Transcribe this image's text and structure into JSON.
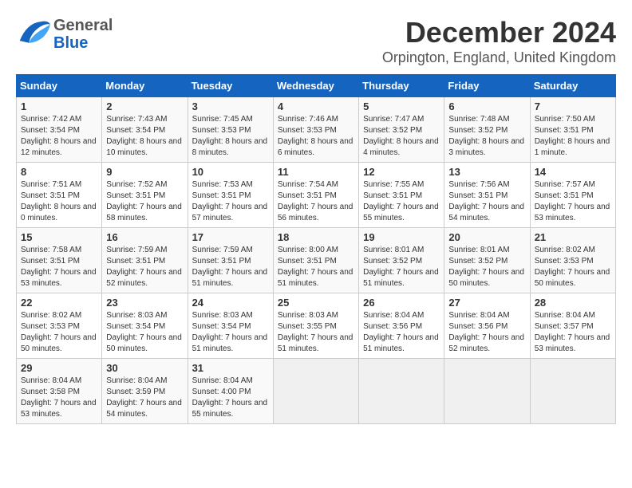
{
  "header": {
    "logo_general": "General",
    "logo_blue": "Blue",
    "title": "December 2024",
    "subtitle": "Orpington, England, United Kingdom"
  },
  "columns": [
    "Sunday",
    "Monday",
    "Tuesday",
    "Wednesday",
    "Thursday",
    "Friday",
    "Saturday"
  ],
  "weeks": [
    [
      {
        "day": "1",
        "sunrise": "Sunrise: 7:42 AM",
        "sunset": "Sunset: 3:54 PM",
        "daylight": "Daylight: 8 hours and 12 minutes."
      },
      {
        "day": "2",
        "sunrise": "Sunrise: 7:43 AM",
        "sunset": "Sunset: 3:54 PM",
        "daylight": "Daylight: 8 hours and 10 minutes."
      },
      {
        "day": "3",
        "sunrise": "Sunrise: 7:45 AM",
        "sunset": "Sunset: 3:53 PM",
        "daylight": "Daylight: 8 hours and 8 minutes."
      },
      {
        "day": "4",
        "sunrise": "Sunrise: 7:46 AM",
        "sunset": "Sunset: 3:53 PM",
        "daylight": "Daylight: 8 hours and 6 minutes."
      },
      {
        "day": "5",
        "sunrise": "Sunrise: 7:47 AM",
        "sunset": "Sunset: 3:52 PM",
        "daylight": "Daylight: 8 hours and 4 minutes."
      },
      {
        "day": "6",
        "sunrise": "Sunrise: 7:48 AM",
        "sunset": "Sunset: 3:52 PM",
        "daylight": "Daylight: 8 hours and 3 minutes."
      },
      {
        "day": "7",
        "sunrise": "Sunrise: 7:50 AM",
        "sunset": "Sunset: 3:51 PM",
        "daylight": "Daylight: 8 hours and 1 minute."
      }
    ],
    [
      {
        "day": "8",
        "sunrise": "Sunrise: 7:51 AM",
        "sunset": "Sunset: 3:51 PM",
        "daylight": "Daylight: 8 hours and 0 minutes."
      },
      {
        "day": "9",
        "sunrise": "Sunrise: 7:52 AM",
        "sunset": "Sunset: 3:51 PM",
        "daylight": "Daylight: 7 hours and 58 minutes."
      },
      {
        "day": "10",
        "sunrise": "Sunrise: 7:53 AM",
        "sunset": "Sunset: 3:51 PM",
        "daylight": "Daylight: 7 hours and 57 minutes."
      },
      {
        "day": "11",
        "sunrise": "Sunrise: 7:54 AM",
        "sunset": "Sunset: 3:51 PM",
        "daylight": "Daylight: 7 hours and 56 minutes."
      },
      {
        "day": "12",
        "sunrise": "Sunrise: 7:55 AM",
        "sunset": "Sunset: 3:51 PM",
        "daylight": "Daylight: 7 hours and 55 minutes."
      },
      {
        "day": "13",
        "sunrise": "Sunrise: 7:56 AM",
        "sunset": "Sunset: 3:51 PM",
        "daylight": "Daylight: 7 hours and 54 minutes."
      },
      {
        "day": "14",
        "sunrise": "Sunrise: 7:57 AM",
        "sunset": "Sunset: 3:51 PM",
        "daylight": "Daylight: 7 hours and 53 minutes."
      }
    ],
    [
      {
        "day": "15",
        "sunrise": "Sunrise: 7:58 AM",
        "sunset": "Sunset: 3:51 PM",
        "daylight": "Daylight: 7 hours and 53 minutes."
      },
      {
        "day": "16",
        "sunrise": "Sunrise: 7:59 AM",
        "sunset": "Sunset: 3:51 PM",
        "daylight": "Daylight: 7 hours and 52 minutes."
      },
      {
        "day": "17",
        "sunrise": "Sunrise: 7:59 AM",
        "sunset": "Sunset: 3:51 PM",
        "daylight": "Daylight: 7 hours and 51 minutes."
      },
      {
        "day": "18",
        "sunrise": "Sunrise: 8:00 AM",
        "sunset": "Sunset: 3:51 PM",
        "daylight": "Daylight: 7 hours and 51 minutes."
      },
      {
        "day": "19",
        "sunrise": "Sunrise: 8:01 AM",
        "sunset": "Sunset: 3:52 PM",
        "daylight": "Daylight: 7 hours and 51 minutes."
      },
      {
        "day": "20",
        "sunrise": "Sunrise: 8:01 AM",
        "sunset": "Sunset: 3:52 PM",
        "daylight": "Daylight: 7 hours and 50 minutes."
      },
      {
        "day": "21",
        "sunrise": "Sunrise: 8:02 AM",
        "sunset": "Sunset: 3:53 PM",
        "daylight": "Daylight: 7 hours and 50 minutes."
      }
    ],
    [
      {
        "day": "22",
        "sunrise": "Sunrise: 8:02 AM",
        "sunset": "Sunset: 3:53 PM",
        "daylight": "Daylight: 7 hours and 50 minutes."
      },
      {
        "day": "23",
        "sunrise": "Sunrise: 8:03 AM",
        "sunset": "Sunset: 3:54 PM",
        "daylight": "Daylight: 7 hours and 50 minutes."
      },
      {
        "day": "24",
        "sunrise": "Sunrise: 8:03 AM",
        "sunset": "Sunset: 3:54 PM",
        "daylight": "Daylight: 7 hours and 51 minutes."
      },
      {
        "day": "25",
        "sunrise": "Sunrise: 8:03 AM",
        "sunset": "Sunset: 3:55 PM",
        "daylight": "Daylight: 7 hours and 51 minutes."
      },
      {
        "day": "26",
        "sunrise": "Sunrise: 8:04 AM",
        "sunset": "Sunset: 3:56 PM",
        "daylight": "Daylight: 7 hours and 51 minutes."
      },
      {
        "day": "27",
        "sunrise": "Sunrise: 8:04 AM",
        "sunset": "Sunset: 3:56 PM",
        "daylight": "Daylight: 7 hours and 52 minutes."
      },
      {
        "day": "28",
        "sunrise": "Sunrise: 8:04 AM",
        "sunset": "Sunset: 3:57 PM",
        "daylight": "Daylight: 7 hours and 53 minutes."
      }
    ],
    [
      {
        "day": "29",
        "sunrise": "Sunrise: 8:04 AM",
        "sunset": "Sunset: 3:58 PM",
        "daylight": "Daylight: 7 hours and 53 minutes."
      },
      {
        "day": "30",
        "sunrise": "Sunrise: 8:04 AM",
        "sunset": "Sunset: 3:59 PM",
        "daylight": "Daylight: 7 hours and 54 minutes."
      },
      {
        "day": "31",
        "sunrise": "Sunrise: 8:04 AM",
        "sunset": "Sunset: 4:00 PM",
        "daylight": "Daylight: 7 hours and 55 minutes."
      },
      null,
      null,
      null,
      null
    ]
  ]
}
